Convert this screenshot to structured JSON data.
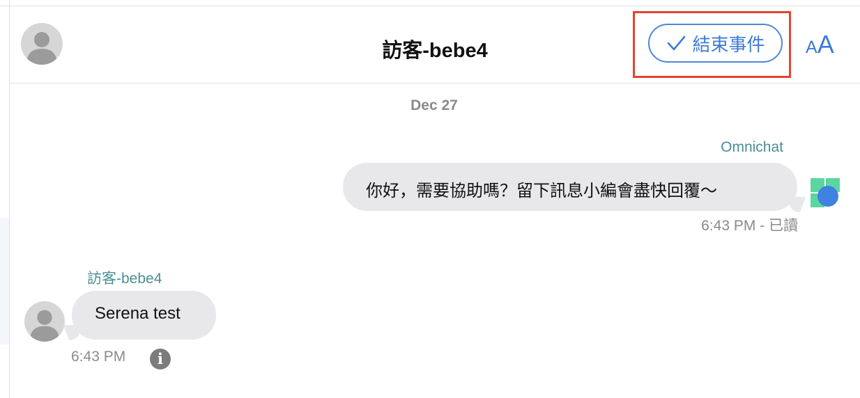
{
  "header": {
    "title": "訪客-bebe4",
    "end_button_label": "結束事件",
    "font_size_small": "A",
    "font_size_large": "A"
  },
  "conversation": {
    "date": "Dec 27",
    "messages": [
      {
        "direction": "outgoing",
        "sender": "Omnichat",
        "text": "你好，需要協助嗎？留下訊息小編會盡快回覆～",
        "meta": "6:43 PM - 已讀"
      },
      {
        "direction": "incoming",
        "sender": "訪客-bebe4",
        "text": "Serena test",
        "time": "6:43 PM"
      }
    ]
  },
  "icons": {
    "info": "i",
    "check": "check-icon",
    "avatar": "user-avatar-icon",
    "bot_logo": "omnichat-logo-icon"
  },
  "colors": {
    "accent": "#3d7bd6",
    "sender_name": "#4a8f94",
    "bubble": "#e8e8eb",
    "highlight": "#e2442b"
  }
}
